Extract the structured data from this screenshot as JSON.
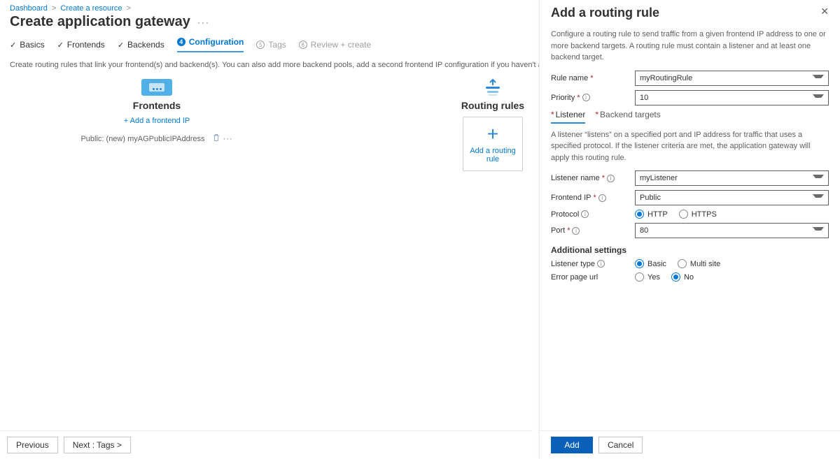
{
  "breadcrumb": {
    "dashboard": "Dashboard",
    "create_resource": "Create a resource"
  },
  "page_title": "Create application gateway",
  "wizard_tabs": {
    "basics": "Basics",
    "frontends": "Frontends",
    "backends": "Backends",
    "configuration": "Configuration",
    "tags_num": "5",
    "tags": "Tags",
    "review_num": "6",
    "review": "Review + create"
  },
  "instruction": "Create routing rules that link your frontend(s) and backend(s). You can also add more backend pools, add a second frontend IP configuration if you haven't already, or edit previous configurations.",
  "frontends": {
    "title": "Frontends",
    "add_link": "+ Add a frontend IP",
    "ip_row": "Public: (new) myAGPublicIPAddress"
  },
  "routing_rules": {
    "title": "Routing rules",
    "add_label": "Add a routing rule"
  },
  "footer": {
    "previous": "Previous",
    "next": "Next : Tags >"
  },
  "panel": {
    "title": "Add a routing rule",
    "description": "Configure a routing rule to send traffic from a given frontend IP address to one or more backend targets. A routing rule must contain a listener and at least one backend target.",
    "rule_name_label": "Rule name",
    "rule_name_value": "myRoutingRule",
    "priority_label": "Priority",
    "priority_value": "10",
    "tabs": {
      "listener": "Listener",
      "backend": "Backend targets"
    },
    "listener_desc": "A listener “listens” on a specified port and IP address for traffic that uses a specified protocol. If the listener criteria are met, the application gateway will apply this routing rule.",
    "listener_name_label": "Listener name",
    "listener_name_value": "myListener",
    "frontend_ip_label": "Frontend IP",
    "frontend_ip_value": "Public",
    "protocol_label": "Protocol",
    "protocol_http": "HTTP",
    "protocol_https": "HTTPS",
    "port_label": "Port",
    "port_value": "80",
    "additional_settings": "Additional settings",
    "listener_type_label": "Listener type",
    "listener_type_basic": "Basic",
    "listener_type_multi": "Multi site",
    "error_page_label": "Error page url",
    "error_page_yes": "Yes",
    "error_page_no": "No",
    "add": "Add",
    "cancel": "Cancel"
  }
}
